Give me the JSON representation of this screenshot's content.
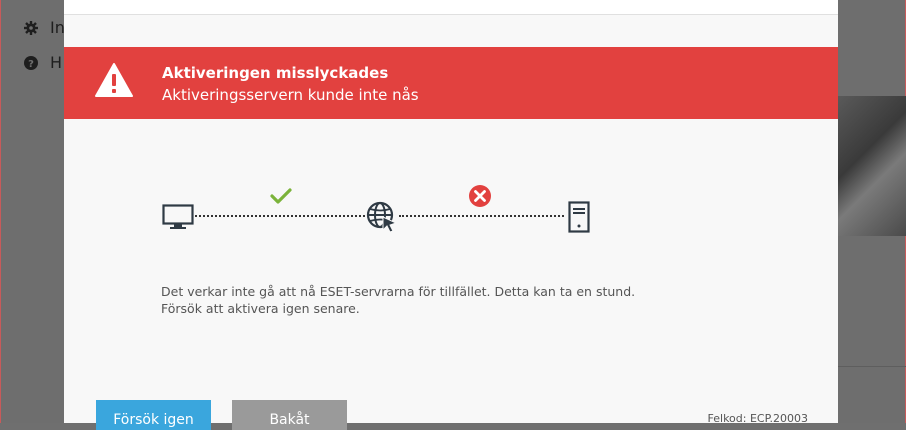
{
  "background": {
    "nav_items": [
      {
        "icon": "gear-icon",
        "label": "In"
      },
      {
        "icon": "help-icon",
        "label": "H"
      }
    ]
  },
  "dialog": {
    "banner": {
      "color": "#e2413f",
      "icon": "warning-triangle-icon",
      "title": "Aktiveringen misslyckades",
      "subtitle": "Aktiveringsservern kunde inte nås"
    },
    "diagram": {
      "nodes": [
        "computer-icon",
        "globe-cursor-icon",
        "server-icon"
      ],
      "link_status": [
        {
          "icon": "checkmark-icon",
          "color": "#7bb33a"
        },
        {
          "icon": "error-circle-icon",
          "color": "#e2413f"
        }
      ]
    },
    "message_line1": "Det verkar inte gå att nå ESET-servrarna för tillfället. Detta kan ta en stund.",
    "message_line2": "Försök att aktivera igen senare.",
    "buttons": {
      "retry": "Försök igen",
      "back": "Bakåt"
    },
    "error_code": "Felkod: ECP.20003"
  }
}
